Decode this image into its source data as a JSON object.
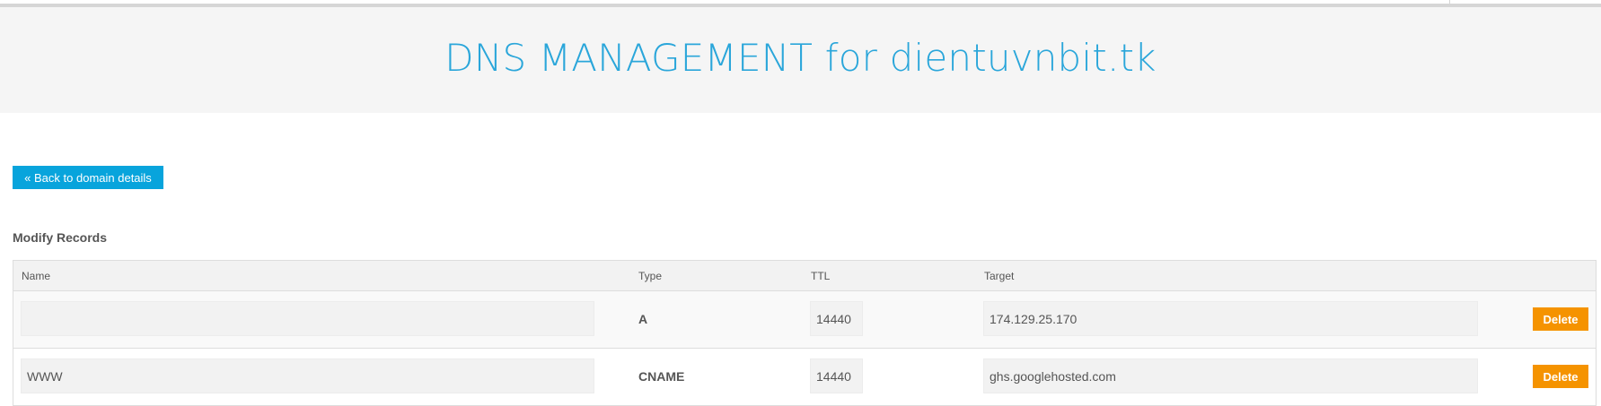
{
  "header": {
    "title": "DNS MANAGEMENT for dientuvnbit.tk"
  },
  "back_button": {
    "label": "« Back to domain details"
  },
  "section": {
    "title": "Modify Records"
  },
  "table": {
    "columns": [
      "Name",
      "Type",
      "TTL",
      "Target"
    ],
    "rows": [
      {
        "name": "",
        "type": "A",
        "ttl": "14440",
        "target": "174.129.25.170",
        "action": "Delete"
      },
      {
        "name": "WWW",
        "type": "CNAME",
        "ttl": "14440",
        "target": "ghs.googlehosted.com",
        "action": "Delete"
      }
    ]
  },
  "colors": {
    "title": "#2aa6da",
    "primary_button": "#08a4dc",
    "delete_button": "#f59300"
  }
}
